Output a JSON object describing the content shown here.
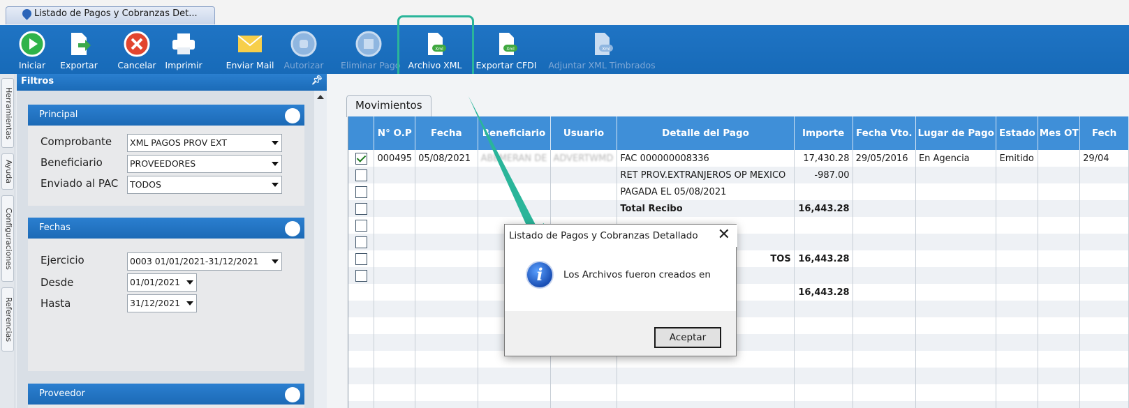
{
  "document_tab": {
    "title": "Listado de Pagos y Cobranzas Det..."
  },
  "toolbar": {
    "buttons": [
      {
        "label": "Iniciar",
        "icon": "play-icon",
        "enabled": true
      },
      {
        "label": "Exportar",
        "icon": "export-icon",
        "enabled": true
      },
      {
        "label": "Cancelar",
        "icon": "cancel-icon",
        "enabled": true
      },
      {
        "label": "Imprimir",
        "icon": "printer-icon",
        "enabled": true
      },
      {
        "label": "Enviar Mail",
        "icon": "mail-icon",
        "enabled": true
      },
      {
        "label": "Autorizar",
        "icon": "authorize-icon",
        "enabled": false
      },
      {
        "label": "Eliminar Pago",
        "icon": "delete-payment-icon",
        "enabled": false
      },
      {
        "label": "Archivo XML",
        "icon": "xml-file-icon",
        "enabled": true,
        "highlighted": true
      },
      {
        "label": "Exportar CFDI",
        "icon": "export-cfdi-icon",
        "enabled": true
      },
      {
        "label": "Adjuntar XML Timbrados",
        "icon": "attach-xml-icon",
        "enabled": false
      }
    ]
  },
  "side_tabs": [
    "Herramientas",
    "Ayuda",
    "Configuraciones",
    "Referencias"
  ],
  "filters": {
    "title": "Filtros",
    "principal": {
      "title": "Principal",
      "comprobante_label": "Comprobante",
      "comprobante_value": "XML PAGOS PROV EXT",
      "beneficiario_label": "Beneficiario",
      "beneficiario_value": "PROVEEDORES",
      "enviado_label": "Enviado al PAC",
      "enviado_value": "TODOS"
    },
    "fechas": {
      "title": "Fechas",
      "ejercicio_label": "Ejercicio",
      "ejercicio_value": "0003 01/01/2021-31/12/2021",
      "desde_label": "Desde",
      "desde_value": "01/01/2021",
      "hasta_label": "Hasta",
      "hasta_value": "31/12/2021"
    },
    "proveedor": {
      "title": "Proveedor"
    }
  },
  "grid": {
    "tab_label": "Movimientos",
    "columns": [
      "N° O.P",
      "Fecha",
      "Beneficiario",
      "Usuario",
      "Detalle del Pago",
      "Importe",
      "Fecha Vto.",
      "Lugar de Pago",
      "Estado",
      "Mes OT",
      "Fech"
    ],
    "rows": [
      {
        "checked": true,
        "op": "000495",
        "fecha": "05/08/2021",
        "beneficiario": "ABEMERAN DE",
        "usuario": "ADVERTWMD",
        "detalle": "FAC 000000008336",
        "importe": "17,430.28",
        "vto": "29/05/2016",
        "lugar": "En Agencia",
        "estado": "Emitido",
        "mes": "",
        "fech": "29/04"
      },
      {
        "checked": false,
        "op": "",
        "fecha": "",
        "beneficiario": "",
        "usuario": "",
        "detalle": "RET PROV.EXTRANJEROS OP MEXICO",
        "importe": "-987.00",
        "vto": "",
        "lugar": "",
        "estado": "",
        "mes": "",
        "fech": ""
      },
      {
        "checked": false,
        "op": "",
        "fecha": "",
        "beneficiario": "",
        "usuario": "",
        "detalle": "PAGADA EL 05/08/2021",
        "importe": "",
        "vto": "",
        "lugar": "",
        "estado": "",
        "mes": "",
        "fech": ""
      },
      {
        "checked": false,
        "op": "",
        "fecha": "",
        "beneficiario": "",
        "usuario": "",
        "detalle": "Total Recibo",
        "importe": "16,443.28",
        "vto": "",
        "lugar": "",
        "estado": "",
        "mes": "",
        "fech": "",
        "bold": true
      },
      {
        "checked": false,
        "op": "",
        "fecha": "",
        "beneficiario": "",
        "usuario": "",
        "detalle": "",
        "importe": "",
        "vto": "",
        "lugar": "",
        "estado": "",
        "mes": "",
        "fech": ""
      },
      {
        "checked": false,
        "op": "",
        "fecha": "",
        "beneficiario": "",
        "usuario": "",
        "detalle": "",
        "importe": "",
        "vto": "",
        "lugar": "",
        "estado": "",
        "mes": "",
        "fech": ""
      },
      {
        "checked": false,
        "op": "",
        "fecha": "",
        "beneficiario": "",
        "usuario": "",
        "detalle": "TOS",
        "importe": "16,443.28",
        "vto": "",
        "lugar": "",
        "estado": "",
        "mes": "",
        "fech": "",
        "bold": true,
        "detalle_right": true
      },
      {
        "checked": false,
        "op": "",
        "fecha": "",
        "beneficiario": "",
        "usuario": "",
        "detalle": "",
        "importe": "",
        "vto": "",
        "lugar": "",
        "estado": "",
        "mes": "",
        "fech": ""
      },
      {
        "checked": null,
        "op": "",
        "fecha": "",
        "beneficiario": "",
        "usuario": "",
        "detalle": "",
        "importe": "16,443.28",
        "vto": "",
        "lugar": "",
        "estado": "",
        "mes": "",
        "fech": "",
        "bold": true
      }
    ],
    "empty_rows": 7
  },
  "dialog": {
    "title": "Listado de Pagos y Cobranzas Detallado",
    "close_symbol": "✕",
    "message": "Los Archivos fueron creados en",
    "ok_label": "Aceptar"
  },
  "colors": {
    "accent": "#1f74c4",
    "highlight": "#2ab59a",
    "grid_header": "#3f8fd8"
  }
}
